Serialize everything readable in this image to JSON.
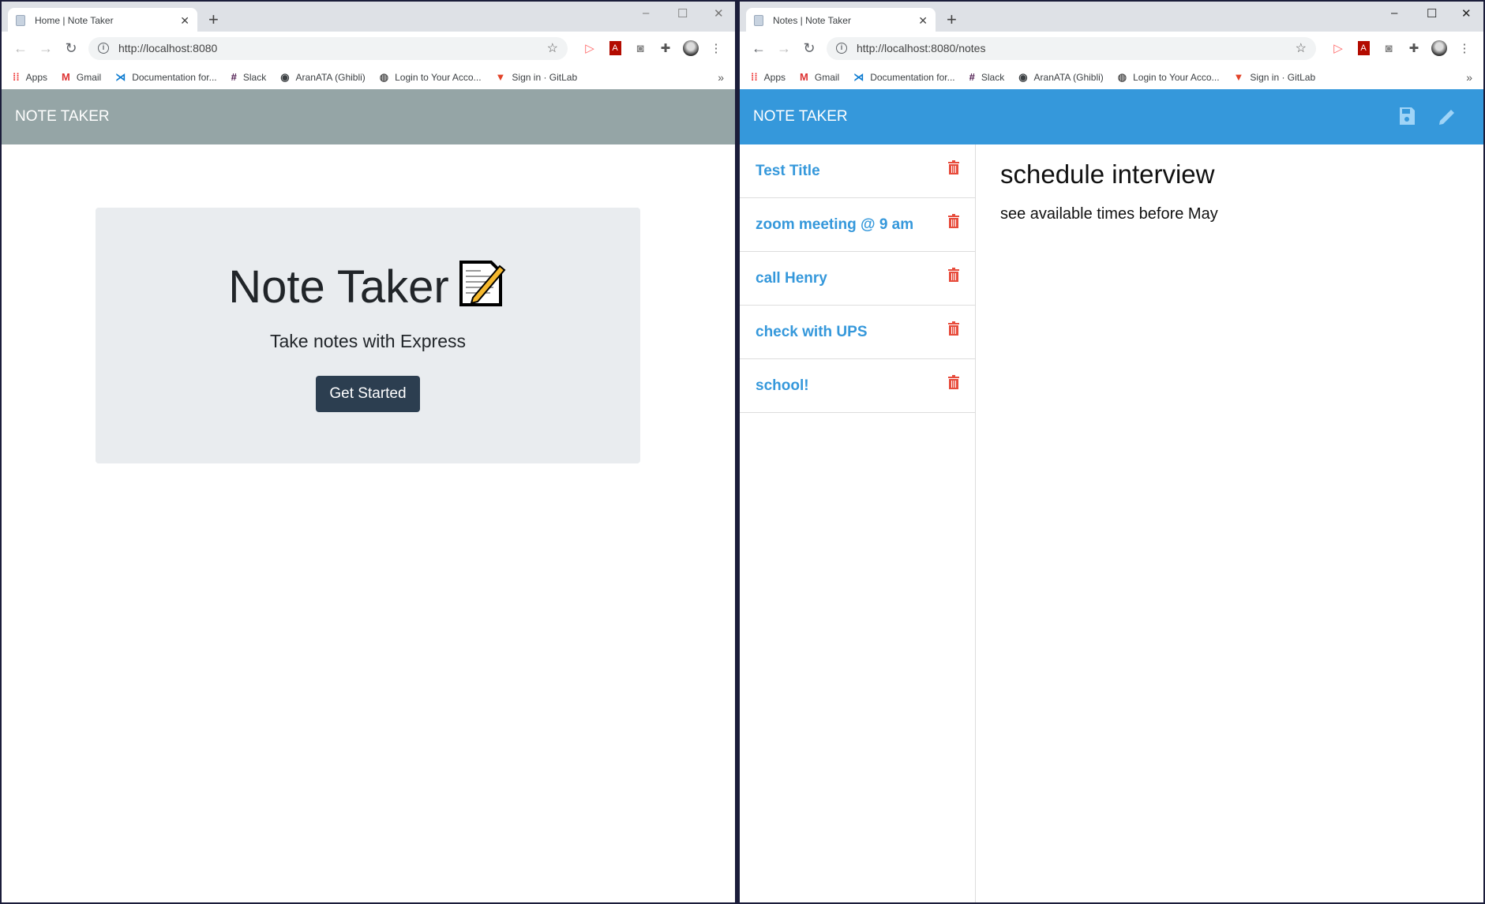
{
  "left": {
    "tab_title": "Home | Note Taker",
    "url": "http://localhost:8080",
    "header": "NOTE TAKER",
    "hero": {
      "title": "Note Taker",
      "emoji": "📝",
      "subtitle": "Take notes with Express",
      "button": "Get Started"
    }
  },
  "right": {
    "tab_title": "Notes | Note Taker",
    "url": "http://localhost:8080/notes",
    "header": "NOTE TAKER",
    "notes": [
      "Test Title",
      "zoom meeting @ 9 am",
      "call Henry",
      "check with UPS",
      "school!"
    ],
    "active": {
      "title": "schedule interview",
      "text": "see available times before May"
    }
  },
  "bookmarks": [
    "Apps",
    "Gmail",
    "Documentation for...",
    "Slack",
    "AranATA (Ghibli)",
    "Login to Your Acco...",
    "Sign in · GitLab"
  ],
  "colors": {
    "header_home": "#95a5a6",
    "header_notes": "#3598db",
    "note_link": "#3598db",
    "trash": "#e74c3c",
    "button": "#2c3e50"
  }
}
